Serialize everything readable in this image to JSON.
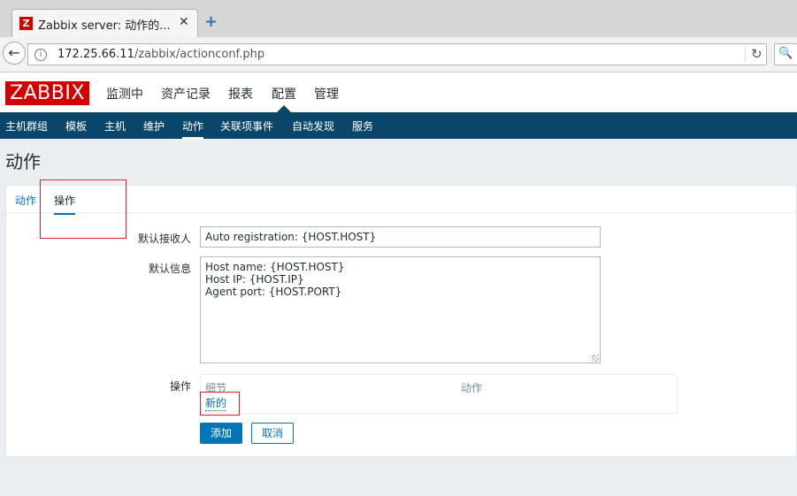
{
  "browser": {
    "tab_title": "Zabbix server: 动作的...",
    "tab_favicon": "Z",
    "tab_close": "✕",
    "new_tab": "+",
    "url_host": "172.25.66.11",
    "url_path": "/zabbix/actionconf.php",
    "search_glyph": "🔍"
  },
  "header": {
    "logo": "ZABBIX",
    "menu": [
      "监测中",
      "资产记录",
      "报表",
      "配置",
      "管理"
    ],
    "active_menu": "配置"
  },
  "subnav": {
    "items": [
      "主机群组",
      "模板",
      "主机",
      "维护",
      "动作",
      "关联项事件",
      "自动发现",
      "服务"
    ],
    "active": "动作"
  },
  "page": {
    "title": "动作",
    "tabs": [
      "动作",
      "操作"
    ],
    "active_tab": "操作"
  },
  "form": {
    "default_recipient_label": "默认接收人",
    "default_recipient_value": "Auto registration: {HOST.HOST}",
    "default_message_label": "默认信息",
    "default_message_lines": [
      "Host name: {HOST.HOST}",
      "Host IP: {HOST.IP}",
      "Agent port: {HOST.PORT}"
    ],
    "operations_label": "操作",
    "operations_col_details": "细节",
    "operations_col_action": "动作",
    "new_link": "新的"
  },
  "buttons": {
    "add": "添加",
    "cancel": "取消"
  },
  "colors": {
    "brand_red": "#d40000",
    "nav_blue": "#0a466a",
    "link_blue": "#0275b8",
    "highlight_red": "#e0202a"
  },
  "icons": [
    "back-arrow-icon",
    "info-icon",
    "reload-icon",
    "search-icon",
    "close-icon",
    "new-tab-icon"
  ]
}
